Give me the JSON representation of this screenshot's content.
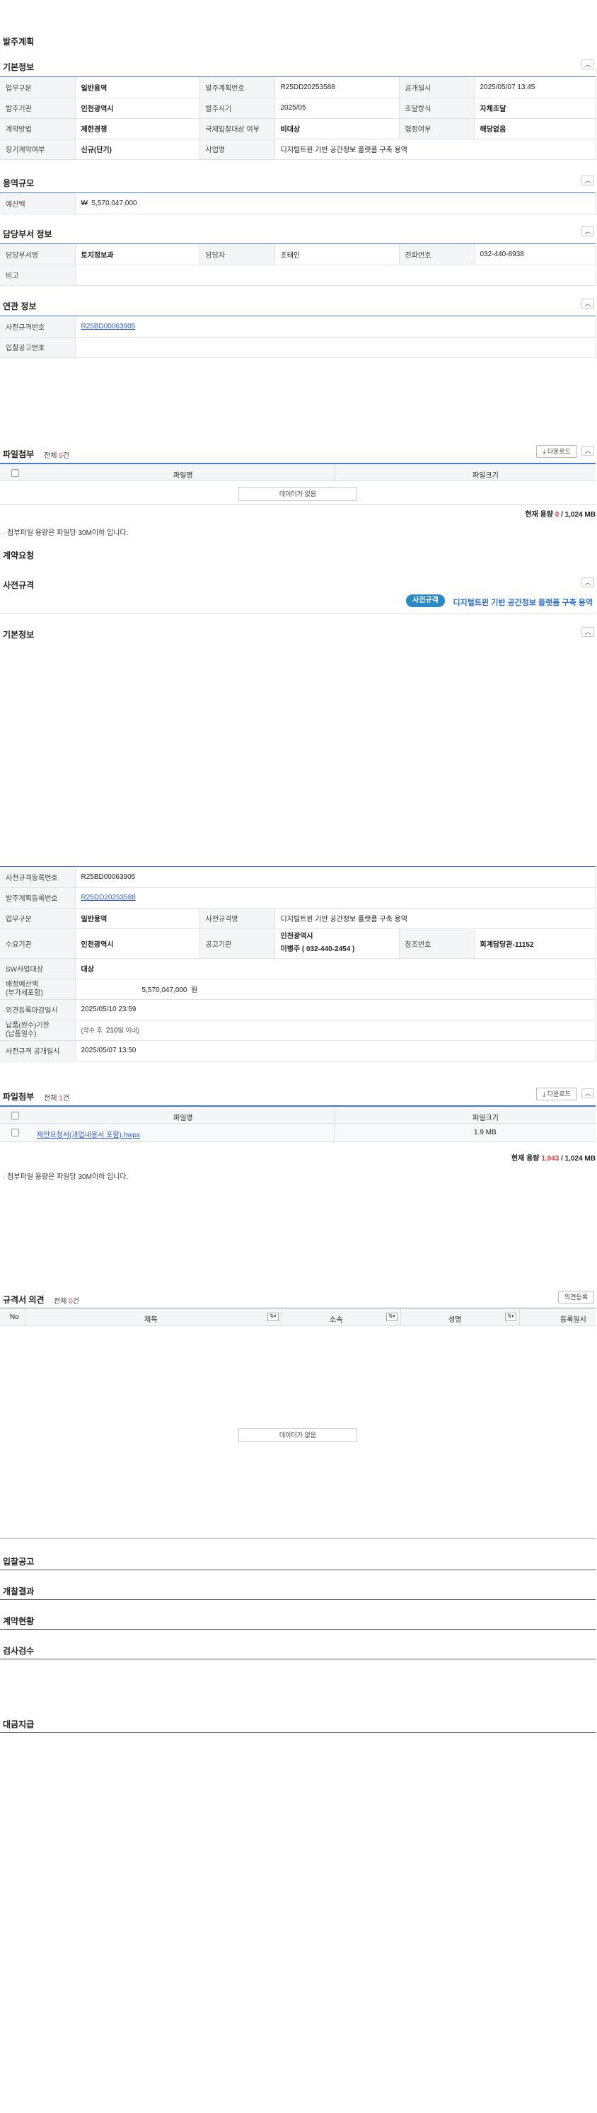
{
  "order_plan": {
    "title": "발주계획",
    "basic": {
      "title": "기본정보",
      "rows": [
        [
          {
            "label": "업무구분",
            "value": "일반용역",
            "bold": true
          },
          {
            "label": "발주계획번호",
            "value": "R25DD20253588"
          },
          {
            "label": "공개일시",
            "value": "2025/05/07 13:45"
          }
        ],
        [
          {
            "label": "발주기관",
            "value": "인천광역시",
            "bold": true
          },
          {
            "label": "발주시기",
            "value": "2025/05"
          },
          {
            "label": "조달방식",
            "value": "자체조달",
            "bold": true
          }
        ],
        [
          {
            "label": "계약방법",
            "value": "제한경쟁",
            "bold": true
          },
          {
            "label": "국제입찰대상 여부",
            "value": "비대상",
            "bold": true
          },
          {
            "label": "협정여부",
            "value": "해당없음",
            "bold": true
          }
        ],
        [
          {
            "label": "장기계약여부",
            "value": "신규(단기)",
            "bold": true
          },
          {
            "label": "사업명",
            "value": "디지털트윈 기반 공간정보 플랫폼 구축 용역"
          }
        ]
      ]
    },
    "scale": {
      "title": "용역규모",
      "budget_label": "예산액",
      "currency": "₩",
      "budget_value": "5,570,047,000"
    },
    "dept": {
      "title": "담당부서 정보",
      "dept_label": "담당부서명",
      "dept_value": "토지정보과",
      "person_label": "담당자",
      "person_value": "조태인",
      "phone_label": "전화번호",
      "phone_value": "032-440-8938",
      "remark_label": "비고"
    },
    "related": {
      "title": "연관 정보",
      "prespec_label": "사전규격번호",
      "prespec_value": "R25BD00063905",
      "bid_label": "입찰공고번호"
    },
    "attach": {
      "title": "파일첨부",
      "total_prefix": "전체 ",
      "total_count": "0",
      "total_suffix": "건",
      "download_label": "⤓ 다운로드",
      "col_name": "파일명",
      "col_size": "파일크기",
      "no_data": "데이터가 없음",
      "cap_prefix": "현재 용량 ",
      "cap_used": "0",
      "cap_total": " / 1,024 MB",
      "note": "첨부파일 용량은 파일당 30M이하 입니다."
    }
  },
  "contract_request": {
    "title": "계약요청"
  },
  "prespec": {
    "title": "사전규격",
    "badge": "사전규격",
    "spec_title": "디지털트윈 기반 공간정보 플랫폼 구축 용역",
    "basic": {
      "title": "기본정보",
      "reg_no_label": "사전규격등록번호",
      "reg_no_value": "R25BD00063905",
      "plan_no_label": "발주계획등록번호",
      "plan_no_value": "R25DD20253588",
      "work_label": "업무구분",
      "work_value": "일반용역",
      "name_label": "사전규격명",
      "name_value": "디지털트윈 기반 공간정보 플랫폼 구축 용역",
      "demand_label": "수요기관",
      "demand_value": "인천광역시",
      "notice_org_label": "공고기관",
      "notice_org_line1": "인천광역시",
      "notice_org_line2": "이병주 ( 032-440-2454 )",
      "ref_label": "참조번호",
      "ref_value": "회계담당관-11152",
      "sw_label": "SW사업대상",
      "sw_value": "대상",
      "budget_label1": "배정예산액",
      "budget_label2": "(부가세포함)",
      "budget_value": "5,570,047,000",
      "budget_unit": "원",
      "deadline_label": "의견등록마감일시",
      "deadline_value": "2025/05/10 23:59",
      "period_label1": "납품(완수)기한",
      "period_label2": "(납품일수)",
      "period_prefix": "(착수 후",
      "period_days": "210",
      "period_suffix": "일 이내)",
      "open_label": "사전규격 공개일시",
      "open_value": "2025/05/07 13:50"
    },
    "attach": {
      "title": "파일첨부",
      "total_prefix": "전체 ",
      "total_count": "1",
      "total_suffix": "건",
      "download_label": "⤓ 다운로드",
      "col_name": "파일명",
      "col_size": "파일크기",
      "file_name": "제안요청서(과업내용서 포함).hwpx",
      "file_size": "1.9 MB",
      "cap_prefix": "현재 용량 ",
      "cap_used": "1.943",
      "cap_total": " / 1,024 MB",
      "note": "첨부파일 용량은 파일당 30M이하 입니다."
    }
  },
  "opinion": {
    "title": "규격서 의견",
    "total_prefix": "전체 ",
    "total_count": "0",
    "total_suffix": "건",
    "register_label": "의견등록",
    "cols": [
      "No",
      "제목",
      "소속",
      "성명",
      "등록일시"
    ],
    "no_data": "데이터가 없음"
  },
  "sections": {
    "bid_notice": "입찰공고",
    "opening": "개찰결과",
    "contract_status": "계약현황",
    "inspection": "검사검수",
    "payment": "대금지급"
  },
  "icons": {
    "collapse": "chevron-up-icon",
    "download": "download-icon",
    "sort": "sort-icon"
  },
  "colors": {
    "accent": "#4a78c9",
    "badge": "#2b89c6",
    "link": "#2f5bd2",
    "count_red": "#e04040"
  }
}
